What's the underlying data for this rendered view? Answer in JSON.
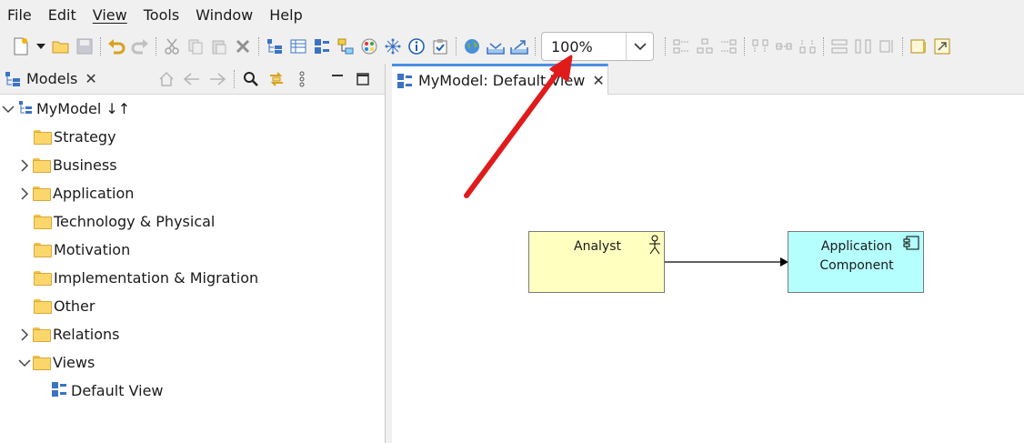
{
  "menu": [
    "File",
    "Edit",
    "View",
    "Tools",
    "Window",
    "Help"
  ],
  "toolbar": {
    "zoom_value": "100%",
    "icons": [
      "new-icon",
      "dropdown-icon",
      "open-folder-icon",
      "save-icon",
      "undo-icon",
      "redo-icon",
      "cut-icon",
      "copy-icon",
      "paste-icon",
      "delete-icon",
      "model-tree-icon",
      "properties-icon",
      "outline-icon",
      "navigator-icon",
      "palette-icon",
      "visualiser-icon",
      "info-icon",
      "validator-icon",
      "web-browser-icon",
      "import-icon",
      "export-icon",
      "align-icons",
      "match-size-icon",
      "layout-icons",
      "properties-pane-icon",
      "maximize-icon"
    ]
  },
  "models_panel": {
    "tab_label": "Models",
    "tools": [
      "home-icon",
      "back-icon",
      "forward-icon",
      "search-icon",
      "sync-icon",
      "view-menu-icon",
      "minimize-icon",
      "maximize-icon"
    ],
    "tree": {
      "root": "MyModel ↓↑",
      "folders": [
        {
          "label": "Strategy",
          "expandable": false
        },
        {
          "label": "Business",
          "expandable": true
        },
        {
          "label": "Application",
          "expandable": true
        },
        {
          "label": "Technology & Physical",
          "expandable": false
        },
        {
          "label": "Motivation",
          "expandable": false
        },
        {
          "label": "Implementation & Migration",
          "expandable": false
        },
        {
          "label": "Other",
          "expandable": false
        },
        {
          "label": "Relations",
          "expandable": true
        },
        {
          "label": "Views",
          "expandable": true,
          "expanded": true
        }
      ],
      "view_item": "Default View"
    }
  },
  "editor": {
    "tab_label": "MyModel: Default View",
    "elements": {
      "actor": {
        "name": "Analyst",
        "color": "#ffffbf",
        "icon": "business-actor-icon"
      },
      "app": {
        "name_line1": "Application",
        "name_line2": "Component",
        "color": "#b5ffff",
        "icon": "application-component-icon"
      }
    }
  },
  "annotation": {
    "arrow_color": "#e01b1b",
    "points_to": "export-icon"
  }
}
